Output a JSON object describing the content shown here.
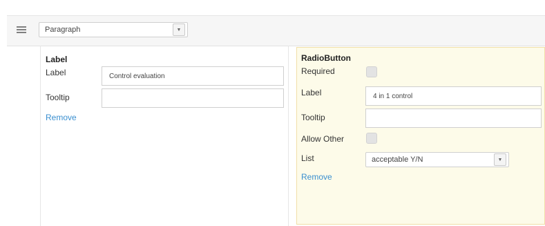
{
  "toolbar": {
    "menu_icon": "hamburger-icon",
    "paragraph_select": {
      "value": "Paragraph",
      "arrow_icon": "chevron-down-icon"
    }
  },
  "label_panel": {
    "title": "Label",
    "label_field": {
      "label": "Label",
      "value": "Control evaluation"
    },
    "tooltip_field": {
      "label": "Tooltip",
      "value": ""
    },
    "remove_label": "Remove"
  },
  "radio_panel": {
    "title": "RadioButton",
    "required": {
      "label": "Required",
      "checked": false
    },
    "label_field": {
      "label": "Label",
      "value": "4 in 1 control"
    },
    "tooltip_field": {
      "label": "Tooltip",
      "value": ""
    },
    "allow_other": {
      "label": "Allow Other",
      "checked": false
    },
    "list_field": {
      "label": "List",
      "value": "acceptable Y/N",
      "arrow_icon": "chevron-down-icon"
    },
    "remove_label": "Remove",
    "highlight_color": "#fdfbe9",
    "border_color": "#f1dfa7"
  },
  "colors": {
    "link": "#3a8fd0"
  }
}
